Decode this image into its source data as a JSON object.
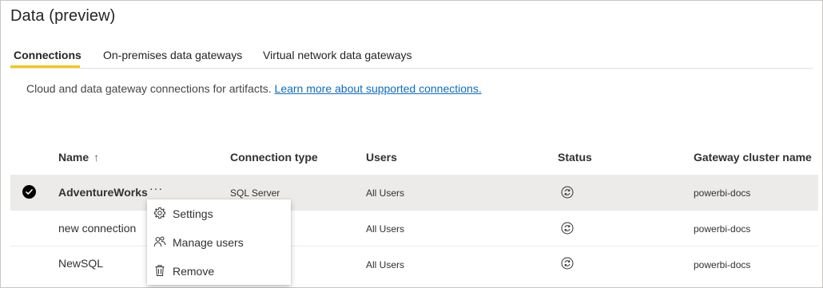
{
  "page": {
    "title": "Data (preview)"
  },
  "tabs": [
    {
      "label": "Connections",
      "active": true
    },
    {
      "label": "On-premises data gateways",
      "active": false
    },
    {
      "label": "Virtual network data gateways",
      "active": false
    }
  ],
  "description": {
    "text": "Cloud and data gateway connections for artifacts.",
    "link_text": "Learn more about supported connections."
  },
  "table": {
    "columns": [
      "Name",
      "Connection type",
      "Users",
      "Status",
      "Gateway cluster name"
    ],
    "sort_indicator": "↑",
    "rows": [
      {
        "name": "AdventureWorks",
        "connection_type": "SQL Server",
        "users": "All Users",
        "status_icon": "refresh-icon",
        "gateway_cluster": "powerbi-docs",
        "selected": true
      },
      {
        "name": "new connection",
        "connection_type": "",
        "users": "All Users",
        "status_icon": "refresh-icon",
        "gateway_cluster": "powerbi-docs",
        "selected": false
      },
      {
        "name": "NewSQL",
        "connection_type": "",
        "users": "All Users",
        "status_icon": "refresh-icon",
        "gateway_cluster": "powerbi-docs",
        "selected": false
      }
    ],
    "more_options": "···"
  },
  "context_menu": {
    "items": [
      {
        "label": "Settings",
        "icon": "gear-icon"
      },
      {
        "label": "Manage users",
        "icon": "users-icon"
      },
      {
        "label": "Remove",
        "icon": "trash-icon"
      }
    ]
  },
  "colors": {
    "accent": "#f2c811",
    "link": "#0f6cbd",
    "selected_row": "#edebe9"
  }
}
